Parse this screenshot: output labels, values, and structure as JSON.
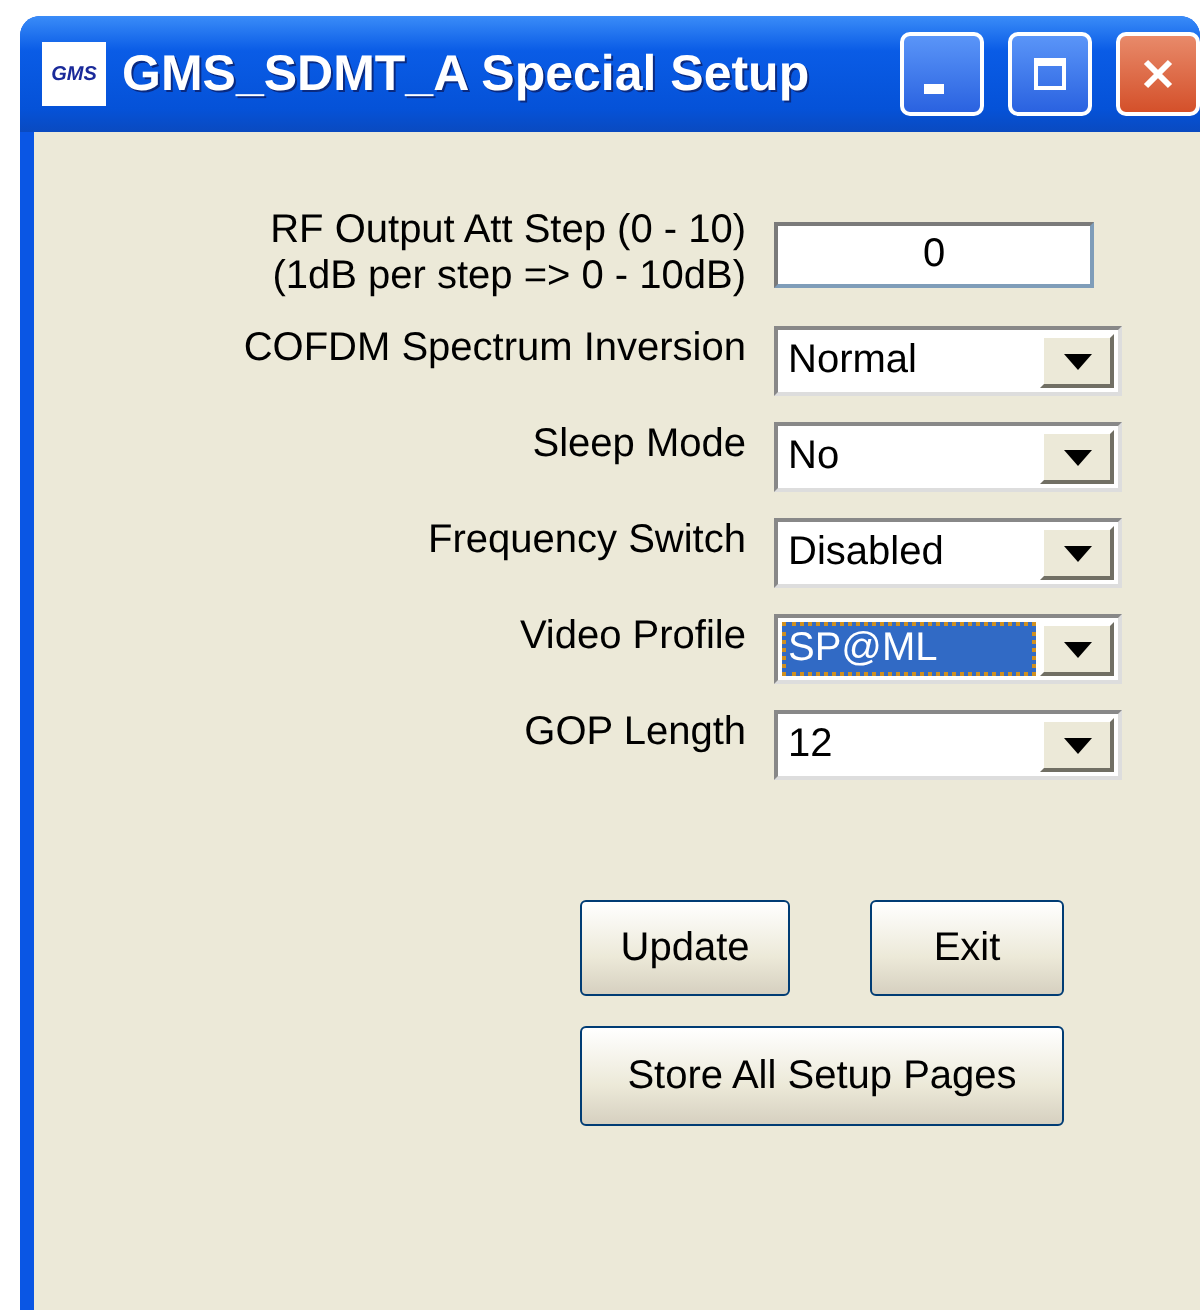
{
  "window": {
    "title": "GMS_SDMT_A Special Setup",
    "icon_text": "GMS"
  },
  "fields": [
    {
      "kind": "text",
      "label": "RF Output Att Step (0 - 10)\n(1dB per step => 0 - 10dB)",
      "value": "0"
    },
    {
      "kind": "combo",
      "label": "COFDM Spectrum Inversion",
      "value": "Normal",
      "selected": false
    },
    {
      "kind": "combo",
      "label": "Sleep Mode",
      "value": "No",
      "selected": false
    },
    {
      "kind": "combo",
      "label": "Frequency Switch",
      "value": "Disabled",
      "selected": false
    },
    {
      "kind": "combo",
      "label": "Video Profile",
      "value": "SP@ML",
      "selected": true
    },
    {
      "kind": "combo",
      "label": "GOP Length",
      "value": "12",
      "selected": false
    }
  ],
  "buttons": [
    {
      "label": "Update"
    },
    {
      "label": "Exit"
    },
    {
      "label": "Store All Setup Pages"
    }
  ]
}
